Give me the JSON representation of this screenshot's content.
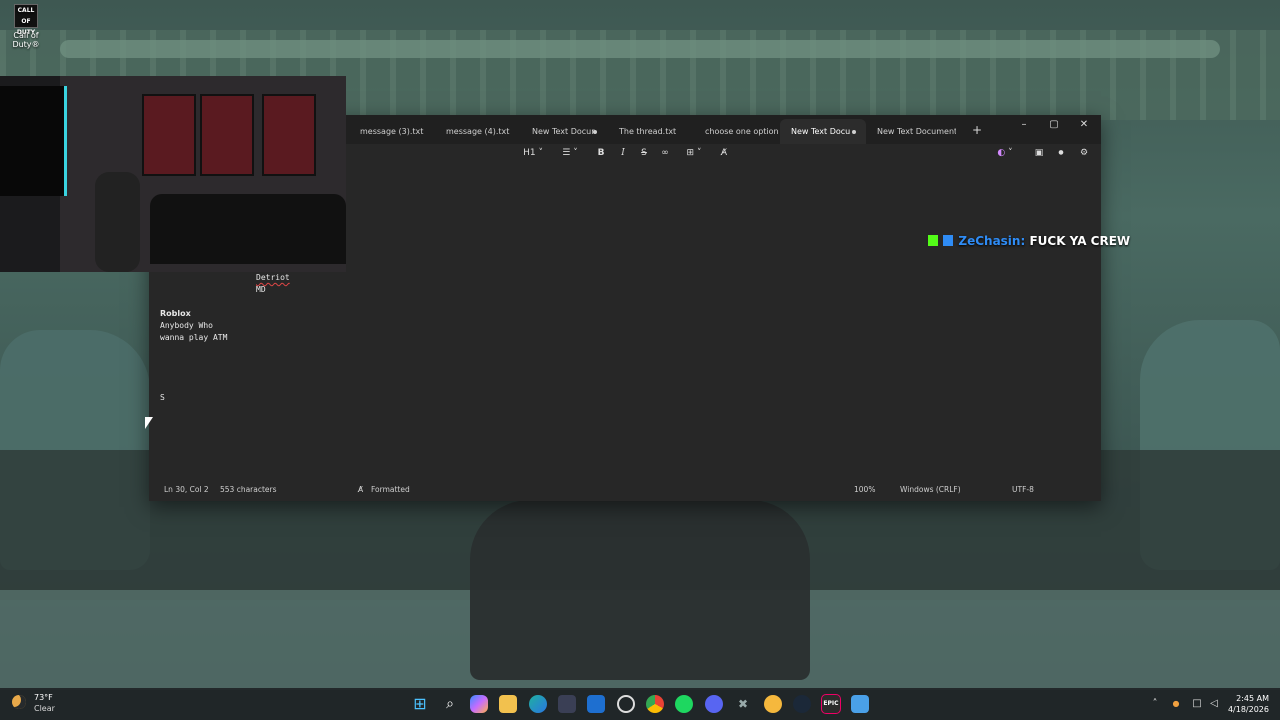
{
  "desktop_icon": {
    "label_line1": "Call of",
    "label_line2": "Duty®",
    "logo_text": "CALL OF DUTY"
  },
  "tabs": [
    {
      "label": "message (3).txt"
    },
    {
      "label": "message (4).txt"
    },
    {
      "label": "New Text Docur",
      "unsaved": true
    },
    {
      "label": "The thread.txt"
    },
    {
      "label": "choose one option - i"
    },
    {
      "label": "New Text Docu",
      "unsaved": true,
      "active": true
    },
    {
      "label": "New Text Document ("
    }
  ],
  "new_tab": "+",
  "window_controls": {
    "minimize": "–",
    "maximize": "▢",
    "close": "✕"
  },
  "toolbar": {
    "heading": "H1",
    "heading_chevron": "˅",
    "list": "☰",
    "list_chevron": "˅",
    "bold": "B",
    "italic": "I",
    "strike": "S",
    "link": "∞",
    "table": "⊞",
    "table_chevron": "˅",
    "clear_format": "A̸",
    "copilot": "◐",
    "copilot_chevron": "˅",
    "announce": "▣",
    "account": "●",
    "settings": "⚙"
  },
  "document": {
    "lines": [
      {
        "text": "Detriot",
        "misspelled": true
      },
      {
        "text": "MD"
      },
      {
        "text": "Roblox",
        "bold": true
      },
      {
        "text": "Anybody Who"
      },
      {
        "text": "wanna play ATM"
      },
      {
        "text": "S"
      }
    ]
  },
  "status": {
    "position": "Ln 30, Col 2",
    "chars": "553 characters",
    "format_icon": "A̸",
    "format": "Formatted",
    "zoom": "100%",
    "line_endings": "Windows (CRLF)",
    "encoding": "UTF-8"
  },
  "chat": {
    "user": "ZeChasin:",
    "message": "FUCK YA CREW",
    "badge_colors": [
      "#53fc18",
      "#2f8cf5"
    ]
  },
  "weather": {
    "temp": "73°F",
    "condition": "Clear"
  },
  "taskbar_icons": [
    "start-icon",
    "search-icon",
    "copilot-icon",
    "file-explorer-icon",
    "edge-icon",
    "store-icon",
    "outlook-icon",
    "chatgpt-icon",
    "chrome-icon",
    "spotify-icon",
    "discord-icon",
    "xbox-icon",
    "chat-icon",
    "steam-icon",
    "epic-games-icon",
    "notepad-icon"
  ],
  "taskbar_glyphs": {
    "start": "⊞",
    "search": "⌕",
    "epic": "EPIC",
    "xbox": "✖"
  },
  "tray": {
    "chevron": "˄",
    "mic": "●",
    "network": "□",
    "volume": "◁"
  },
  "clock": {
    "time": "2:45 AM",
    "date": "4/18/2026"
  }
}
